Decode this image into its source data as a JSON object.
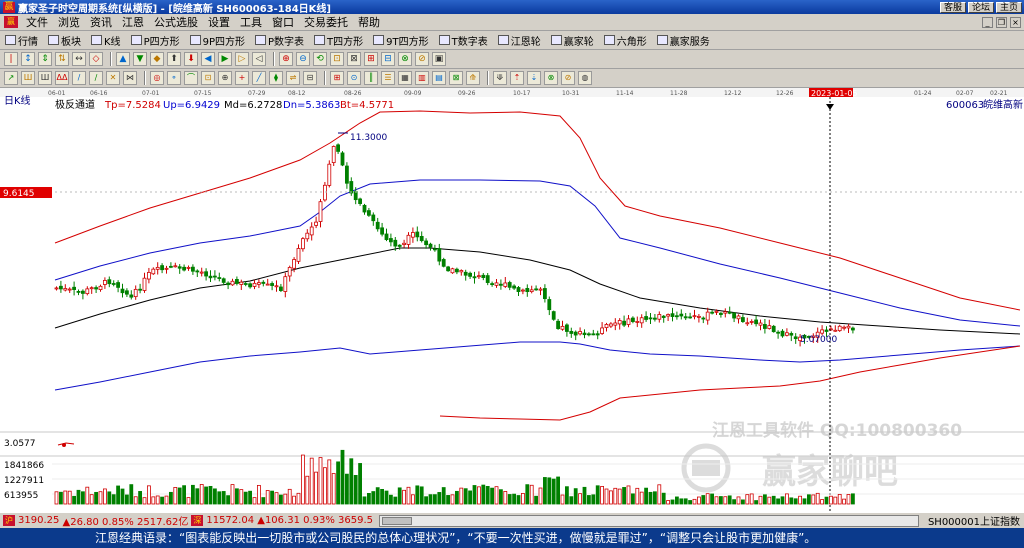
{
  "window": {
    "title": "赢家圣子时空周期系统[纵横版] - [皖维高新  SH600063-184日K线]",
    "buttons": [
      "客服",
      "论坛",
      "主页"
    ]
  },
  "menu": [
    "文件",
    "浏览",
    "资讯",
    "江恩",
    "公式选股",
    "设置",
    "工具",
    "窗口",
    "交易委托",
    "帮助"
  ],
  "toolbar1": [
    {
      "label": "行情",
      "icon": "quote-icon"
    },
    {
      "label": "板块",
      "icon": "sector-icon"
    },
    {
      "label": "K线",
      "icon": "kline-icon"
    },
    {
      "label": "P四方形",
      "icon": "p-square-icon"
    },
    {
      "label": "9P四方形",
      "icon": "9p-square-icon"
    },
    {
      "label": "P数字表",
      "icon": "p-number-icon"
    },
    {
      "label": "T四方形",
      "icon": "t-square-icon"
    },
    {
      "label": "9T四方形",
      "icon": "9t-square-icon"
    },
    {
      "label": "T数字表",
      "icon": "t-number-icon"
    },
    {
      "label": "江恩轮",
      "icon": "gann-wheel-icon"
    },
    {
      "label": "赢家轮",
      "icon": "winner-wheel-icon"
    },
    {
      "label": "六角形",
      "icon": "hexagon-icon"
    },
    {
      "label": "赢家服务",
      "icon": "service-icon"
    }
  ],
  "chart": {
    "period_label": "日K线",
    "indicator_name": "极反通道",
    "indicators": [
      {
        "name": "Tp",
        "value": "=7.5284",
        "color": "#d00000"
      },
      {
        "name": "Up",
        "value": "=6.9429",
        "color": "#0000d0"
      },
      {
        "name": "Md",
        "value": "=6.2728",
        "color": "#000000"
      },
      {
        "name": "Dn",
        "value": "=5.3863",
        "color": "#0000d0"
      },
      {
        "name": "Bt",
        "value": "=4.5771",
        "color": "#d00000"
      }
    ],
    "stock_code": "600063",
    "stock_name": "皖维高新",
    "crosshair_price": "9.6145",
    "crosshair_date": "2023-01-05",
    "high_label": "11.3000",
    "low_label": "5.07000",
    "dates": [
      "06-01",
      "06-16",
      "07-01",
      "07-15",
      "07-29",
      "08-12",
      "08-26",
      "09-09",
      "09-26",
      "10-17",
      "10-31",
      "11-14",
      "11-28",
      "12-12",
      "12-26",
      "2023-01-05",
      "01-24",
      "02-07",
      "02-21"
    ],
    "indicator_level": "3.0577",
    "volume_ticks": [
      "1841866",
      "1227911",
      "613955"
    ],
    "watermark_1": "江恩工具软件  QQ:100800360",
    "watermark_2": "赢家聊吧"
  },
  "status": {
    "sh_index": "3190.25",
    "sh_change": "▲26.80 0.85% 2517.62亿",
    "sz_index": "11572.04",
    "sz_change": "▲106.31 0.93% 3659.5",
    "right": "SH000001上证指数"
  },
  "quote": "江恩经典语录：“图表能反映出一切股市或公司股民的总体心理状况”，“不要一次性买进，做慢就是罪过”，“调整只会让股市更加健康”。",
  "colors": {
    "up": "#d00000",
    "down": "#008000",
    "title_bar": "#0a3a9e",
    "quote_bar": "#0b3a8c"
  }
}
